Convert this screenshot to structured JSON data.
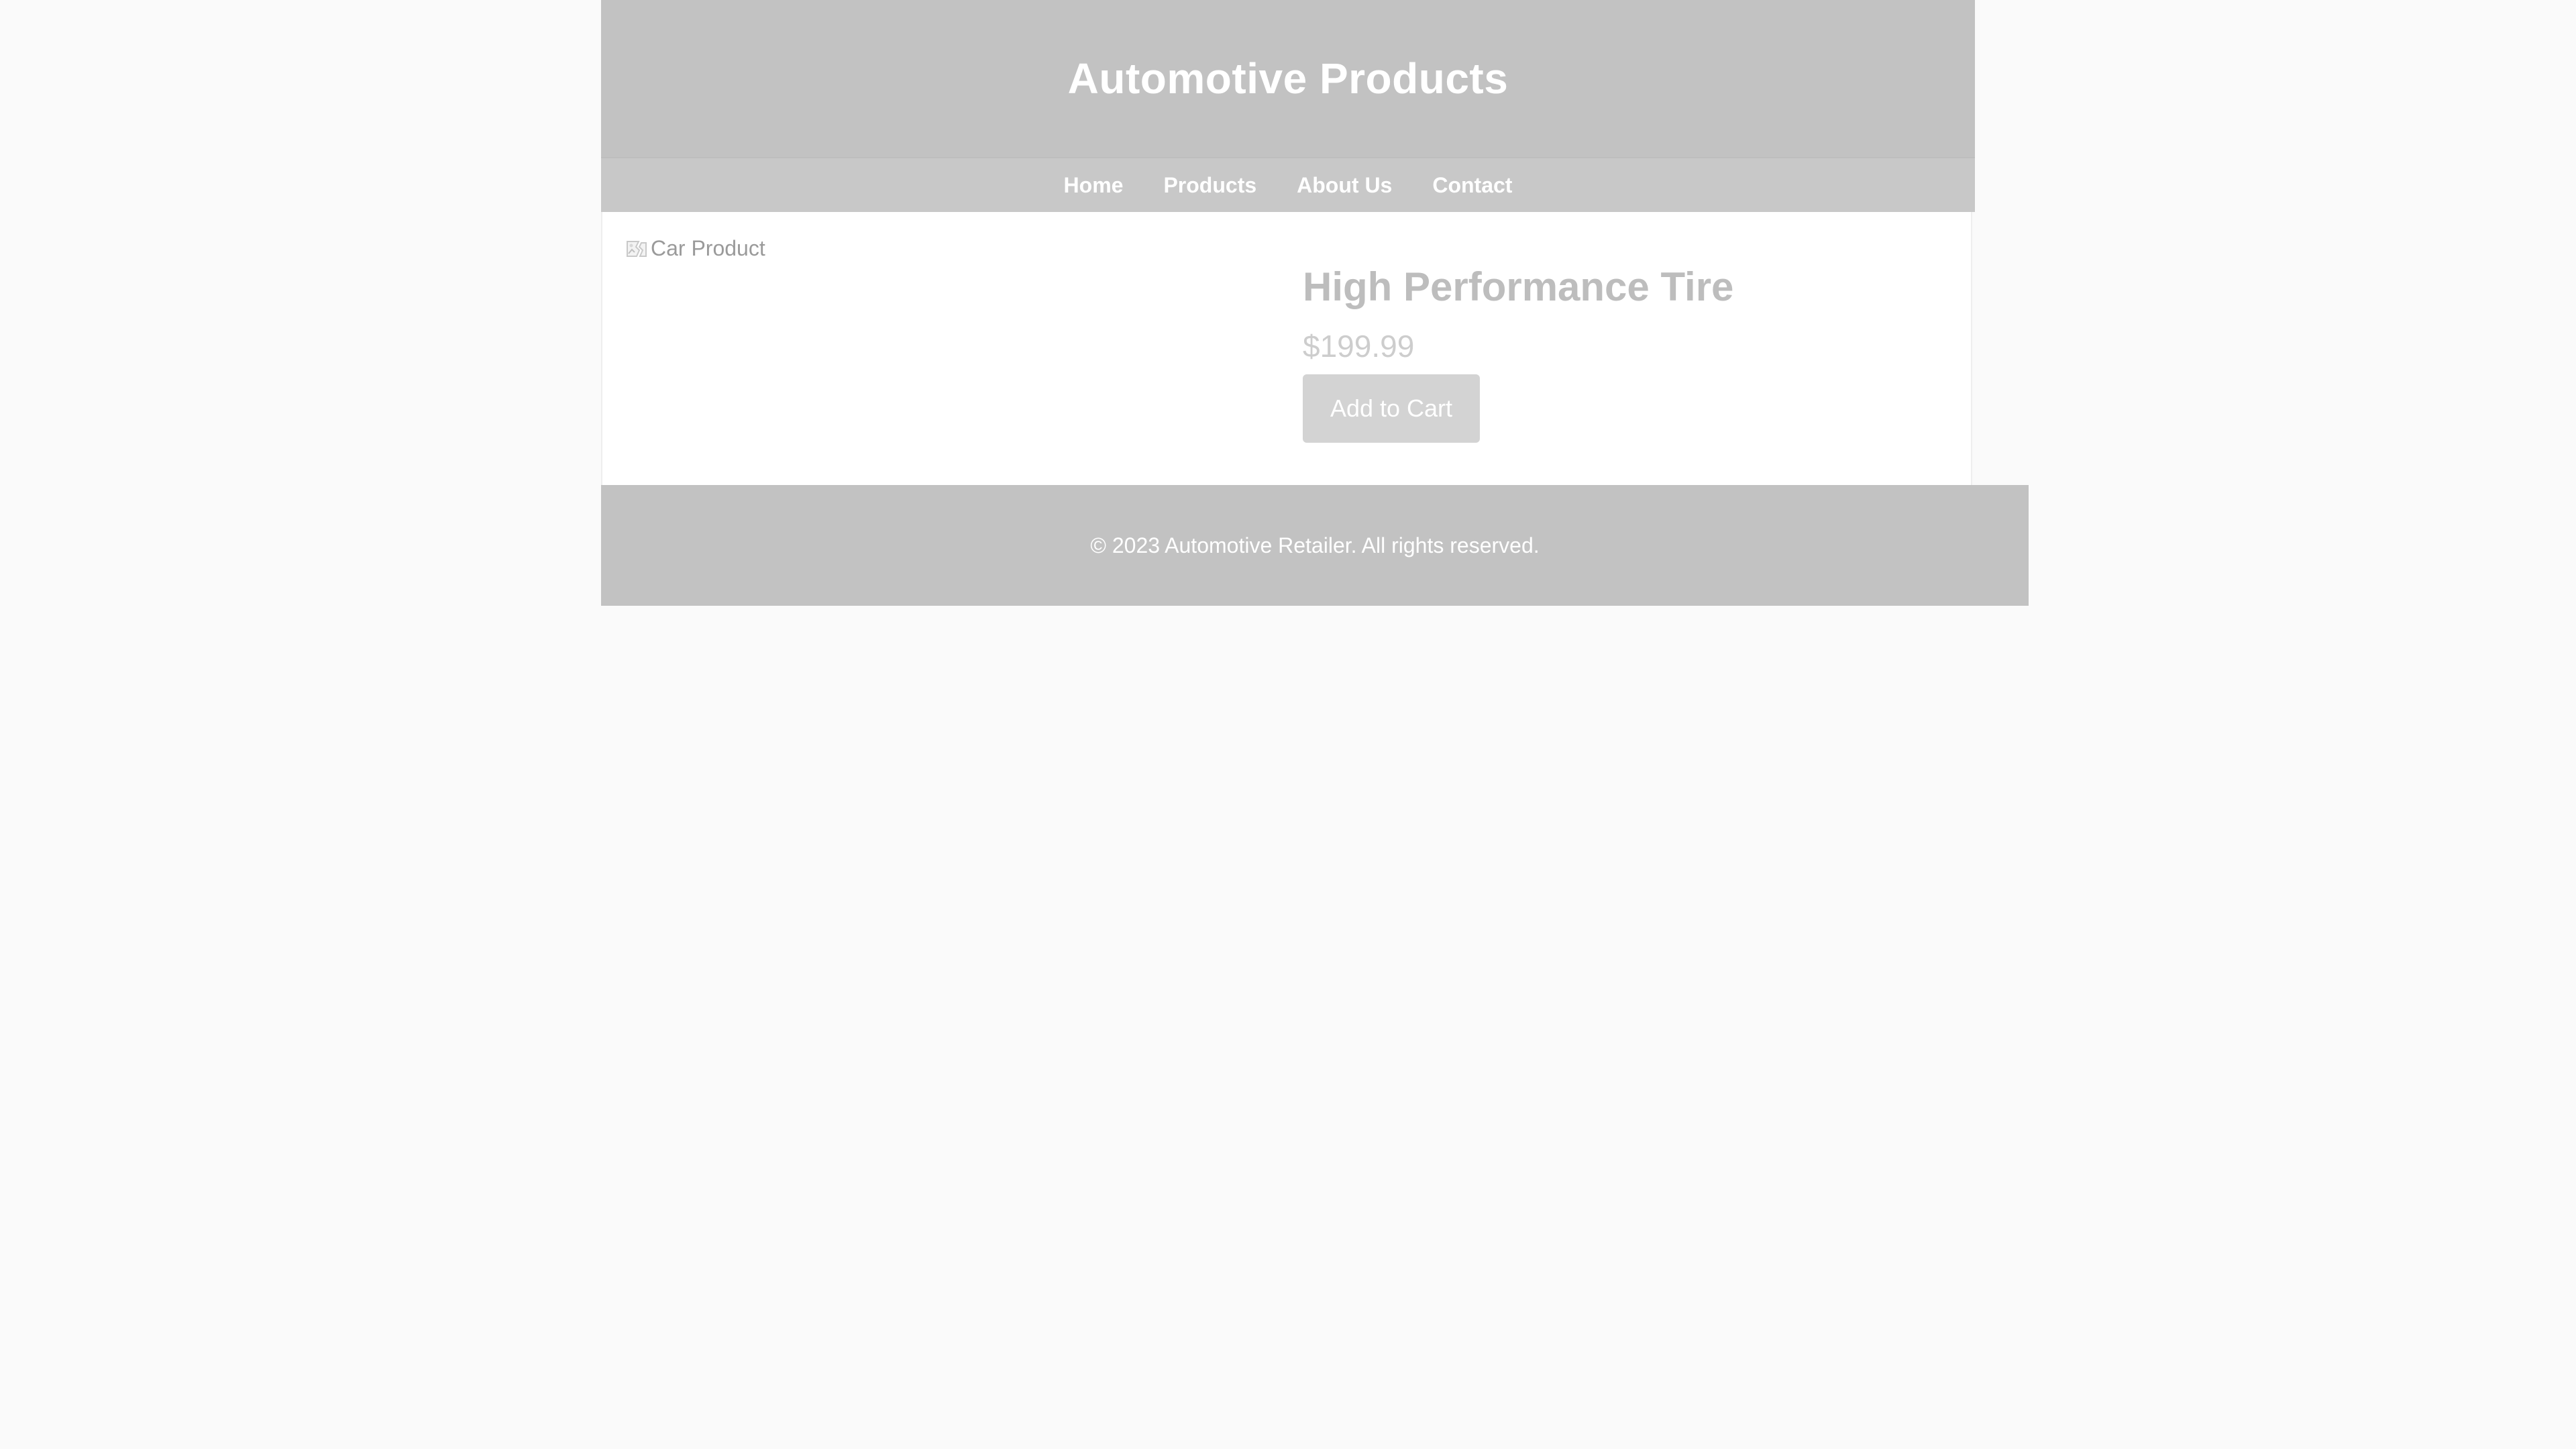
{
  "header": {
    "title": "Automotive Products"
  },
  "nav": {
    "items": [
      {
        "label": "Home"
      },
      {
        "label": "Products"
      },
      {
        "label": "About Us"
      },
      {
        "label": "Contact"
      }
    ]
  },
  "product": {
    "image_alt": "Car Product",
    "image_icon": "broken-image-icon",
    "name": "High Performance Tire",
    "price": "$199.99",
    "add_to_cart_label": "Add to Cart"
  },
  "footer": {
    "text": "© 2023 Automotive Retailer. All rights reserved."
  },
  "colors": {
    "page_background": "#fafafa",
    "header_background": "#c2c2c2",
    "nav_background": "#c8c8c8",
    "button_background": "#d3d3d3",
    "product_name": "#bdbdbd",
    "product_price": "#cdcdcd"
  }
}
